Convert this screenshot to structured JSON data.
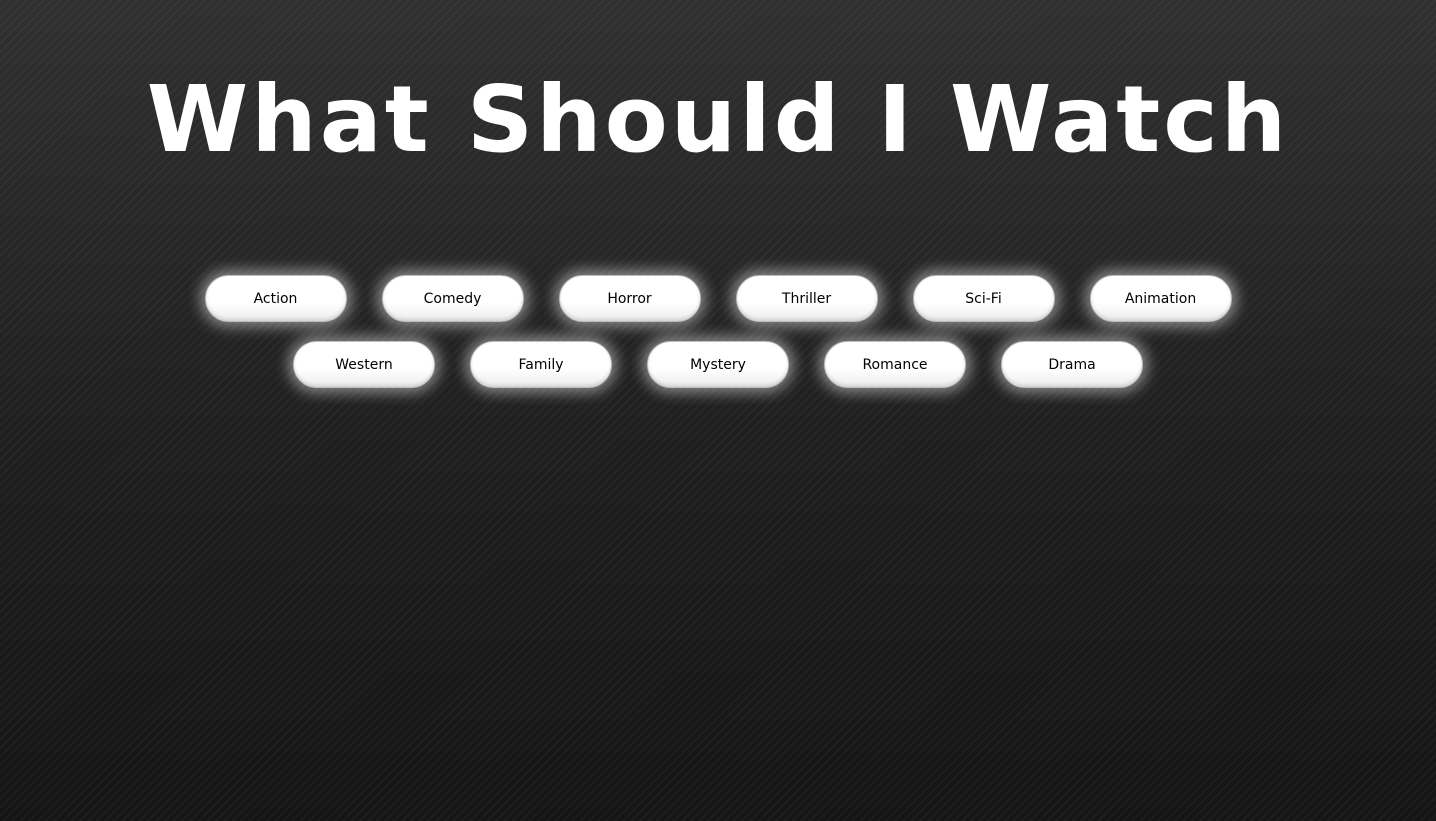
{
  "header": {
    "title": "What Should I Watch"
  },
  "genres": {
    "row1": [
      {
        "label": "Action"
      },
      {
        "label": "Comedy"
      },
      {
        "label": "Horror"
      },
      {
        "label": "Thriller"
      },
      {
        "label": "Sci-Fi"
      },
      {
        "label": "Animation"
      }
    ],
    "row2": [
      {
        "label": "Western"
      },
      {
        "label": "Family"
      },
      {
        "label": "Mystery"
      },
      {
        "label": "Romance"
      },
      {
        "label": "Drama"
      }
    ]
  },
  "colors": {
    "background": "#1c1c1c",
    "title": "#ffffff",
    "button_bg": "#ffffff",
    "button_text": "#000000"
  }
}
